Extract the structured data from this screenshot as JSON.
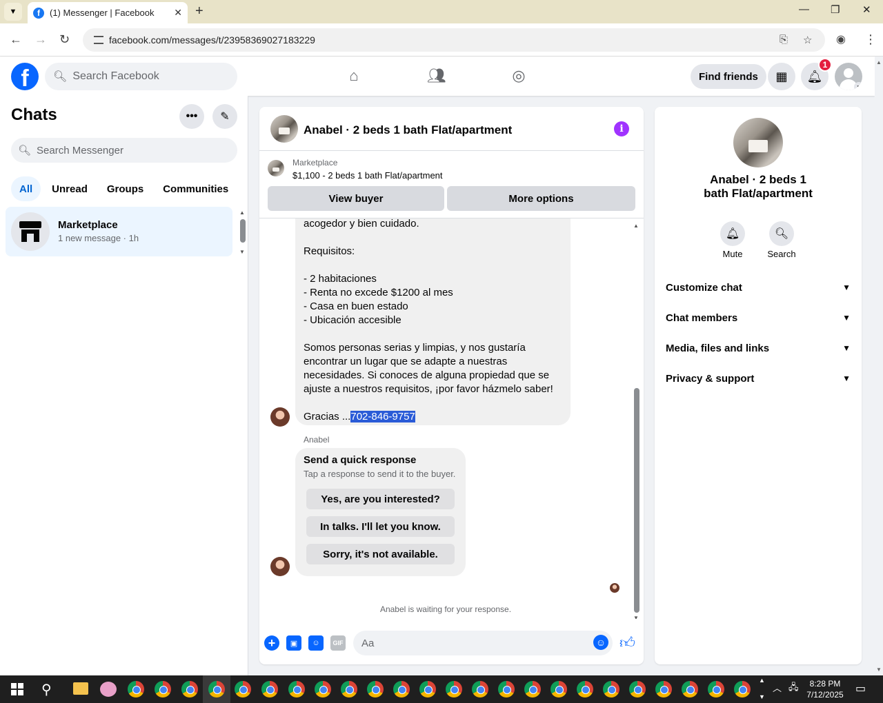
{
  "browser": {
    "tab_title": "(1) Messenger | Facebook",
    "url": "facebook.com/messages/t/23958369027183229"
  },
  "fb_header": {
    "search_placeholder": "Search Facebook",
    "find_friends": "Find friends",
    "notifications_badge": "1"
  },
  "sidebar": {
    "title": "Chats",
    "search_placeholder": "Search Messenger",
    "filters": [
      "All",
      "Unread",
      "Groups",
      "Communities"
    ],
    "chats": [
      {
        "name": "Marketplace",
        "preview": "1 new message · 1h"
      }
    ]
  },
  "conversation": {
    "title": "Anabel · 2 beds 1 bath Flat/apartment",
    "marketplace_label": "Marketplace",
    "listing": "$1,100 - 2 beds 1 bath Flat/apartment",
    "view_buyer": "View buyer",
    "more_options": "More options",
    "message_text": "acogedor y bien cuidado.\n\nRequisitos:\n\n- 2 habitaciones\n- Renta no excede $1200 al mes\n- Casa en buen estado\n- Ubicación accesible\n\nSomos personas serias y limpias, y nos gustaría encontrar un lugar que se adapte a nuestras necesidades. Si conoces de alguna propiedad que se ajuste a nuestros requisitos, ¡por favor házmelo saber!\n\nGracias ...",
    "selected_phone": "702-846-9757",
    "sender": "Anabel",
    "quick_response": {
      "title": "Send a quick response",
      "subtitle": "Tap a response to send it to the buyer.",
      "options": [
        "Yes, are you interested?",
        "In talks. I'll let you know.",
        "Sorry, it's not available."
      ]
    },
    "waiting": "Anabel is waiting for your response.",
    "composer_placeholder": "Aa"
  },
  "info_panel": {
    "name": "Anabel · 2 beds 1 bath Flat/apartment",
    "mute": "Mute",
    "search": "Search",
    "sections": [
      "Customize chat",
      "Chat members",
      "Media, files and links",
      "Privacy & support"
    ]
  },
  "taskbar": {
    "time": "8:28 PM",
    "date": "7/12/2025"
  },
  "colors": {
    "fb_blue": "#0866ff",
    "selection": "#2a5bd7",
    "active_filter_bg": "#ebf5ff",
    "info_purple": "#a033ff"
  }
}
